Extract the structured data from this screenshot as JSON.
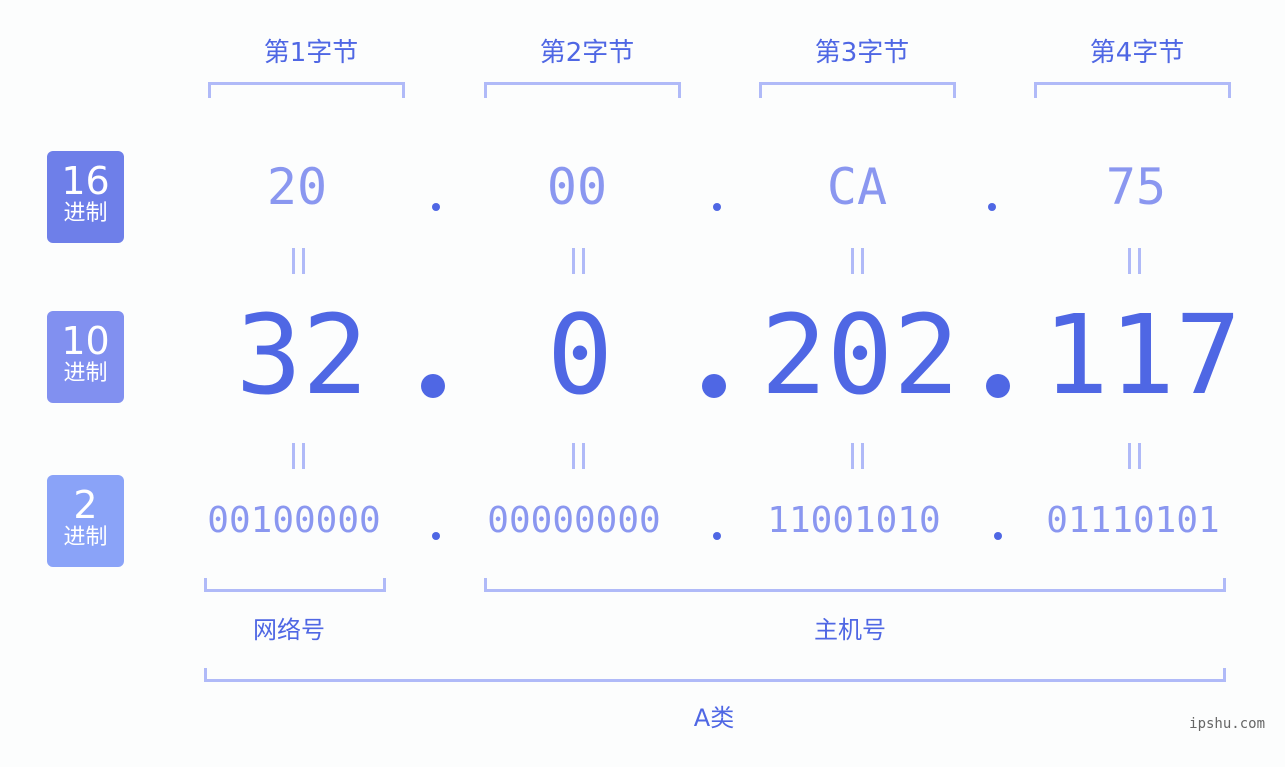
{
  "rows": {
    "hex": {
      "num": "16",
      "label": "进制",
      "color": "#6e7fe9"
    },
    "dec": {
      "num": "10",
      "label": "进制",
      "color": "#8190f0"
    },
    "bin": {
      "num": "2",
      "label": "进制",
      "color": "#8aa3f8"
    }
  },
  "bytes": [
    {
      "header": "第1字节",
      "hex": "20",
      "dec": "32",
      "bin": "00100000"
    },
    {
      "header": "第2字节",
      "hex": "00",
      "dec": "0",
      "bin": "00000000"
    },
    {
      "header": "第3字节",
      "hex": "CA",
      "dec": "202",
      "bin": "11001010"
    },
    {
      "header": "第4字节",
      "hex": "75",
      "dec": "117",
      "bin": "01110101"
    }
  ],
  "network_label": "网络号",
  "host_label": "主机号",
  "class_label": "A类",
  "watermark": "ipshu.com"
}
